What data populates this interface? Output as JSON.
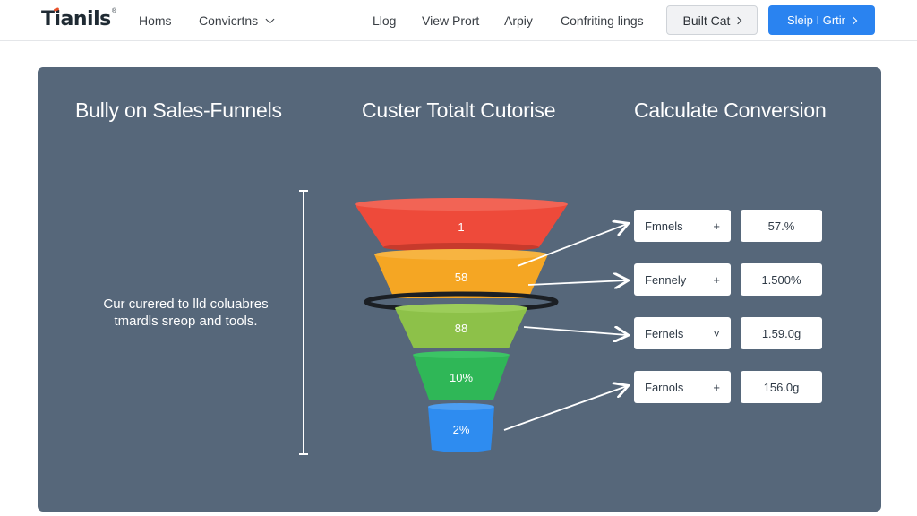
{
  "brand": {
    "name": "Tianils",
    "tm": "®",
    "accent": "#e8512a"
  },
  "nav": {
    "home": "Homs",
    "conversions": "Convicrtns",
    "blog": "Llog",
    "view_profile": "View Prort",
    "apply": "Arpiy",
    "settings": "Confriting lings",
    "built_cat": "Built Cat",
    "signup": "Sleip I Grtir"
  },
  "headings": {
    "left": "Bully on Sales-Funnels",
    "center": "Custer Totalt Cutorise",
    "right": "Calculate Conversion"
  },
  "description": "Cur curered to lld coluabres tmardls sreop and tools.",
  "funnel": [
    {
      "label": "1",
      "color": "#ee4a3a"
    },
    {
      "label": "58",
      "color": "#f5a623"
    },
    {
      "label": "88",
      "color": "#8dc149"
    },
    {
      "label": "10%",
      "color": "#2fb757"
    },
    {
      "label": "2%",
      "color": "#2e8cf0"
    }
  ],
  "rows": [
    {
      "field": "Fmnels",
      "op": "+",
      "value": "57.%"
    },
    {
      "field": "Fennely",
      "op": "+",
      "value": "1.500%"
    },
    {
      "field": "Fernels",
      "op": "˅",
      "value": "1.59.0g"
    },
    {
      "field": "Farnols",
      "op": "+",
      "value": "156.0g"
    }
  ],
  "colors": {
    "panel": "#56677a",
    "primary": "#2a83f0"
  }
}
